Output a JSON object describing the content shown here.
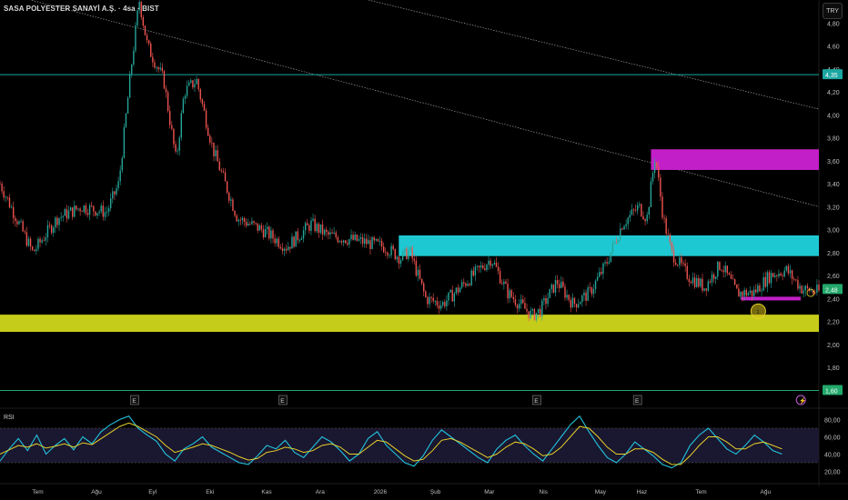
{
  "header": {
    "title": "SASA POLYESTER SANAYİ A.Ş. · 4sa · BIST",
    "currency_button": "TRY"
  },
  "rsi": {
    "label": "RSI"
  },
  "colors": {
    "background": "#000000",
    "up": "#26a69a",
    "down": "#ef5350",
    "cyan": "#1ec8d2",
    "magenta": "#c21fc8",
    "yellow": "#c6cc1a",
    "green_line": "#22a86a",
    "teal_line": "#1ba6a1",
    "rsi_line": "#22c4dd",
    "rsi_ma": "#e6d02a",
    "rsi_band": "#1a1730"
  },
  "chart_data": [
    {
      "type": "candlestick",
      "title": "SASA POLYESTER SANAYİ A.Ş. · 4sa · BIST",
      "y_axis_ticks": [
        "4,80",
        "4,60",
        "4,40",
        "4,20",
        "4,00",
        "3,80",
        "3,60",
        "3,40",
        "3,20",
        "3,00",
        "2,80",
        "2,60",
        "2,40",
        "2,20",
        "2,00",
        "1,80",
        "1,60"
      ],
      "x_axis_ticks": [
        "Tem",
        "Ağu",
        "Eyl",
        "Eki",
        "Kas",
        "Ara",
        "2026",
        "Şub",
        "Mar",
        "Nis",
        "May",
        "Haz",
        "Tem",
        "Ağu"
      ],
      "ylim": [
        1.58,
        5.0
      ],
      "price_path": [
        [
          0,
          3.4
        ],
        [
          0.02,
          3.1
        ],
        [
          0.04,
          2.8
        ],
        [
          0.07,
          3.1
        ],
        [
          0.1,
          3.2
        ],
        [
          0.13,
          3.15
        ],
        [
          0.145,
          3.4
        ],
        [
          0.16,
          4.4
        ],
        [
          0.17,
          5.0
        ],
        [
          0.18,
          4.6
        ],
        [
          0.2,
          4.3
        ],
        [
          0.215,
          3.6
        ],
        [
          0.225,
          4.2
        ],
        [
          0.24,
          4.3
        ],
        [
          0.26,
          3.7
        ],
        [
          0.27,
          3.5
        ],
        [
          0.29,
          3.1
        ],
        [
          0.32,
          3.0
        ],
        [
          0.35,
          2.85
        ],
        [
          0.38,
          3.05
        ],
        [
          0.4,
          2.95
        ],
        [
          0.44,
          2.9
        ],
        [
          0.47,
          2.85
        ],
        [
          0.49,
          2.75
        ],
        [
          0.5,
          2.82
        ],
        [
          0.52,
          2.4
        ],
        [
          0.54,
          2.35
        ],
        [
          0.57,
          2.55
        ],
        [
          0.6,
          2.75
        ],
        [
          0.62,
          2.45
        ],
        [
          0.65,
          2.25
        ],
        [
          0.66,
          2.3
        ],
        [
          0.68,
          2.55
        ],
        [
          0.7,
          2.35
        ],
        [
          0.72,
          2.45
        ],
        [
          0.74,
          2.7
        ],
        [
          0.76,
          3.05
        ],
        [
          0.78,
          3.2
        ],
        [
          0.79,
          3.1
        ],
        [
          0.8,
          3.65
        ],
        [
          0.81,
          3.1
        ],
        [
          0.82,
          2.8
        ],
        [
          0.84,
          2.6
        ],
        [
          0.86,
          2.5
        ],
        [
          0.88,
          2.7
        ],
        [
          0.9,
          2.45
        ],
        [
          0.92,
          2.45
        ],
        [
          0.94,
          2.6
        ],
        [
          0.96,
          2.65
        ],
        [
          0.98,
          2.48
        ],
        [
          1.0,
          2.46
        ]
      ],
      "last_price": "2,48",
      "horizontal_levels": [
        {
          "price": 4.35,
          "label": "4,35",
          "color": "teal_line"
        },
        {
          "price": 1.6,
          "label": "1,60",
          "color": "green_line"
        }
      ],
      "zones": [
        {
          "from": 3.52,
          "to": 3.7,
          "color": "magenta",
          "x_from": 0.795,
          "x_to": 1.0
        },
        {
          "from": 2.77,
          "to": 2.95,
          "color": "cyan",
          "x_from": 0.487,
          "x_to": 1.0
        },
        {
          "from": 2.11,
          "to": 2.26,
          "color": "yellow",
          "x_from": 0.0,
          "x_to": 1.0
        }
      ],
      "support_segment": {
        "price": 2.4,
        "x_from": 0.905,
        "x_to": 1.0
      },
      "trendlines": [
        {
          "from": [
            0.0,
            5.07
          ],
          "to": [
            1.0,
            3.2
          ]
        },
        {
          "from": [
            0.45,
            5.0
          ],
          "to": [
            1.0,
            4.05
          ]
        }
      ],
      "event_markers": [
        {
          "x": 0.164,
          "text": "E"
        },
        {
          "x": 0.345,
          "text": "E"
        },
        {
          "x": 0.655,
          "text": "E"
        },
        {
          "x": 0.778,
          "text": "E"
        },
        {
          "x": 0.978,
          "text": "⚡"
        }
      ],
      "pattern_labels": [
        {
          "x": 0.926,
          "price": 2.29,
          "text": "1"
        },
        {
          "x": 0.99,
          "price": 2.45,
          "text": "D"
        }
      ],
      "grid": false
    },
    {
      "type": "line",
      "title": "RSI",
      "y_axis_ticks": [
        "80,00",
        "60,00",
        "40,00",
        "20,00"
      ],
      "ylim": [
        10,
        90
      ],
      "band": [
        30,
        70
      ],
      "series": [
        {
          "values": [
            32,
            46,
            58,
            44,
            62,
            40,
            50,
            58,
            45,
            60,
            52,
            66,
            74,
            80,
            84,
            70,
            62,
            55,
            40,
            32,
            46,
            52,
            60,
            48,
            42,
            36,
            30,
            28,
            38,
            50,
            46,
            56,
            42,
            36,
            48,
            60,
            54,
            44,
            32,
            40,
            58,
            66,
            50,
            40,
            30,
            26,
            38,
            56,
            68,
            60,
            52,
            44,
            36,
            30,
            46,
            56,
            62,
            50,
            40,
            32,
            46,
            60,
            74,
            84,
            66,
            50,
            36,
            30,
            40,
            54,
            46,
            38,
            28,
            24,
            30,
            50,
            62,
            70,
            58,
            46,
            40,
            50,
            62,
            54,
            44,
            40
          ]
        },
        {
          "values": [
            40,
            45,
            50,
            48,
            52,
            47,
            49,
            52,
            48,
            53,
            51,
            58,
            65,
            72,
            76,
            72,
            66,
            60,
            50,
            42,
            45,
            48,
            52,
            50,
            46,
            42,
            37,
            33,
            35,
            42,
            44,
            48,
            46,
            42,
            44,
            50,
            52,
            48,
            40,
            40,
            48,
            56,
            54,
            46,
            38,
            32,
            34,
            44,
            56,
            58,
            54,
            48,
            42,
            36,
            40,
            48,
            54,
            52,
            46,
            38,
            40,
            48,
            60,
            72,
            70,
            60,
            48,
            40,
            40,
            46,
            46,
            42,
            34,
            28,
            28,
            38,
            50,
            60,
            60,
            54,
            46,
            46,
            52,
            54,
            50,
            46
          ]
        }
      ]
    }
  ]
}
